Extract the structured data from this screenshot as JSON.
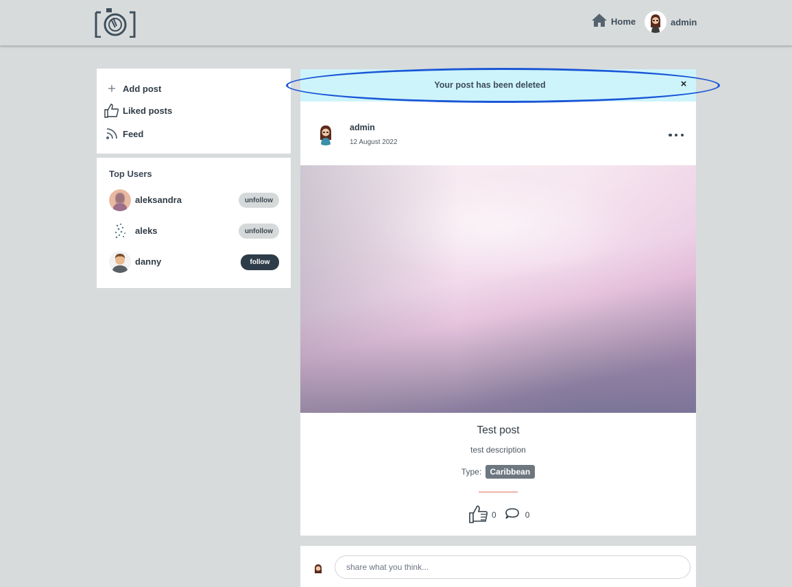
{
  "nav": {
    "logo": "app-logo",
    "home_label": "Home",
    "user_label": "admin"
  },
  "menu": {
    "items": [
      {
        "label": "Add post",
        "icon": "plus-icon"
      },
      {
        "label": "Liked posts",
        "icon": "thumbs-up-icon"
      },
      {
        "label": "Feed",
        "icon": "rss-icon"
      }
    ]
  },
  "top_users": {
    "title": "Top Users",
    "users": [
      {
        "name": "aleksandra",
        "action": "unfollow"
      },
      {
        "name": "aleks",
        "action": "unfollow"
      },
      {
        "name": "danny",
        "action": "follow"
      }
    ]
  },
  "alert": {
    "message": "Your post has been deleted",
    "close": "×",
    "background": "#cdf4fb"
  },
  "post": {
    "author": "admin",
    "date": "12 August 2022",
    "title": "Test post",
    "description": "test description",
    "type_label": "Type:",
    "type_value": "Caribbean",
    "likes": "0",
    "comments": "0"
  },
  "comment_box": {
    "placeholder": "share what you think..."
  },
  "colors": {
    "background": "#d7dbdb",
    "dark": "#2d3c48",
    "divider": "#e26d5f",
    "highlight": "#1a56d6"
  }
}
